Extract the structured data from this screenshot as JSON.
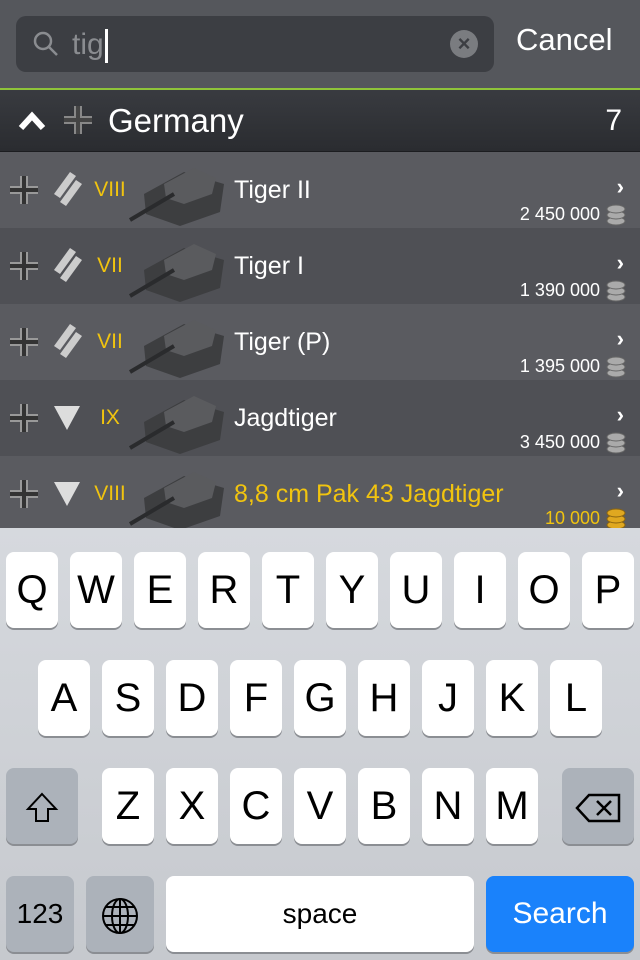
{
  "search": {
    "query": "tig",
    "cancel_label": "Cancel"
  },
  "section": {
    "title": "Germany",
    "count": "7"
  },
  "colors": {
    "accent_green": "#8fc43a",
    "tier_gold": "#f1c40f",
    "search_blue": "#1a82fb"
  },
  "vehicles": [
    {
      "tier": "VIII",
      "name": "Tiger II",
      "price": "2 450 000",
      "currency": "silver-coin-icon",
      "class": "heavy-tank-icon",
      "premium": false
    },
    {
      "tier": "VII",
      "name": "Tiger I",
      "price": "1 390 000",
      "currency": "silver-coin-icon",
      "class": "heavy-tank-icon",
      "premium": false
    },
    {
      "tier": "VII",
      "name": "Tiger (P)",
      "price": "1 395 000",
      "currency": "silver-coin-icon",
      "class": "heavy-tank-icon",
      "premium": false
    },
    {
      "tier": "IX",
      "name": "Jagdtiger",
      "price": "3 450 000",
      "currency": "silver-coin-icon",
      "class": "tank-destroyer-icon",
      "premium": false
    },
    {
      "tier": "VIII",
      "name": "8,8 cm Pak 43 Jagdtiger",
      "price": "10 000",
      "currency": "gold-coin-icon",
      "class": "tank-destroyer-icon",
      "premium": true
    }
  ],
  "keyboard": {
    "row1": [
      "Q",
      "W",
      "E",
      "R",
      "T",
      "Y",
      "U",
      "I",
      "O",
      "P"
    ],
    "row2": [
      "A",
      "S",
      "D",
      "F",
      "G",
      "H",
      "J",
      "K",
      "L"
    ],
    "row3": [
      "Z",
      "X",
      "C",
      "V",
      "B",
      "N",
      "M"
    ],
    "numbers_label": "123",
    "space_label": "space",
    "search_label": "Search"
  }
}
